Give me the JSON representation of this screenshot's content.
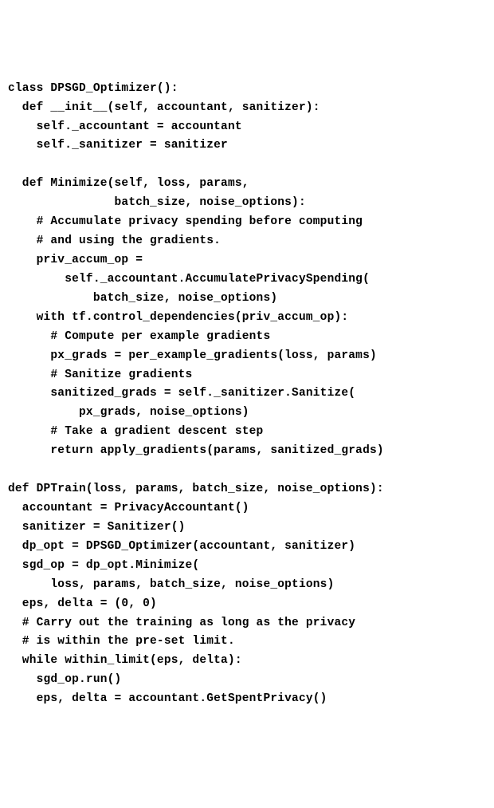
{
  "lines": [
    "class DPSGD_Optimizer():",
    "  def __init__(self, accountant, sanitizer):",
    "    self._accountant = accountant",
    "    self._sanitizer = sanitizer",
    "",
    "  def Minimize(self, loss, params,",
    "               batch_size, noise_options):",
    "    # Accumulate privacy spending before computing",
    "    # and using the gradients.",
    "    priv_accum_op =",
    "        self._accountant.AccumulatePrivacySpending(",
    "            batch_size, noise_options)",
    "    with tf.control_dependencies(priv_accum_op):",
    "      # Compute per example gradients",
    "      px_grads = per_example_gradients(loss, params)",
    "      # Sanitize gradients",
    "      sanitized_grads = self._sanitizer.Sanitize(",
    "          px_grads, noise_options)",
    "      # Take a gradient descent step",
    "      return apply_gradients(params, sanitized_grads)",
    "",
    "def DPTrain(loss, params, batch_size, noise_options):",
    "  accountant = PrivacyAccountant()",
    "  sanitizer = Sanitizer()",
    "  dp_opt = DPSGD_Optimizer(accountant, sanitizer)",
    "  sgd_op = dp_opt.Minimize(",
    "      loss, params, batch_size, noise_options)",
    "  eps, delta = (0, 0)",
    "  # Carry out the training as long as the privacy",
    "  # is within the pre-set limit.",
    "  while within_limit(eps, delta):",
    "    sgd_op.run()",
    "    eps, delta = accountant.GetSpentPrivacy()"
  ]
}
